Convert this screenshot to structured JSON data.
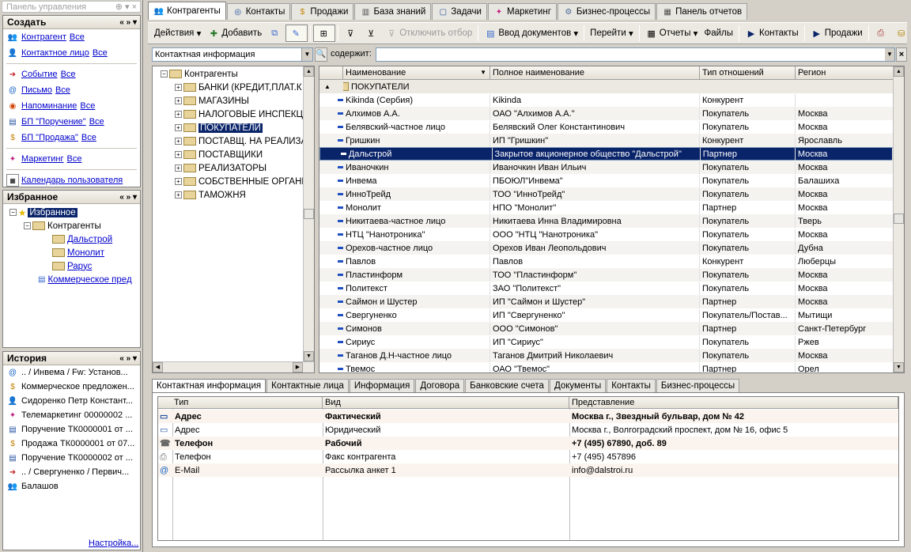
{
  "left_panel": {
    "title": "Панель управления",
    "create": {
      "header": "Создать",
      "items": [
        {
          "label": "Контрагент",
          "all": "Все",
          "icon": "people-icon"
        },
        {
          "label": "Контактное лицо",
          "all": "Все",
          "icon": "person-icon"
        },
        {
          "label": "Событие",
          "all": "Все",
          "icon": "event-icon"
        },
        {
          "label": "Письмо",
          "all": "Все",
          "icon": "mail-icon"
        },
        {
          "label": "Напоминание",
          "all": "Все",
          "icon": "reminder-icon"
        },
        {
          "label": "БП \"Поручение\"",
          "all": "Все",
          "icon": "task-icon"
        },
        {
          "label": "БП \"Продажа\"",
          "all": "Все",
          "icon": "sale-icon"
        },
        {
          "label": "Маркетинг",
          "all": "Все",
          "icon": "marketing-icon"
        }
      ],
      "calendar": "Календарь пользователя"
    },
    "favorites": {
      "header": "Избранное",
      "root": "Избранное",
      "group": "Контрагенты",
      "children": [
        "Дальстрой",
        "Монолит",
        "Рарус"
      ],
      "other": "Коммерческое пред"
    },
    "history": {
      "header": "История",
      "items": [
        ".. / Инвема / Fw: Установ...",
        "Коммерческое предложен...",
        "Сидоренко Петр Констант...",
        "Телемаркетинг 00000002 ...",
        "Поручение ТК0000001 от ...",
        "Продажа ТК0000001 от 07...",
        "Поручение ТК0000002 от ...",
        ".. / Свергуненко / Первич...",
        "Балашов"
      ]
    },
    "settings_link": "Настройка..."
  },
  "tabs": [
    {
      "label": "Контрагенты",
      "icon": "people-icon",
      "active": true
    },
    {
      "label": "Контакты",
      "icon": "contacts-icon"
    },
    {
      "label": "Продажи",
      "icon": "sales-icon"
    },
    {
      "label": "База знаний",
      "icon": "book-icon"
    },
    {
      "label": "Задачи",
      "icon": "tasks-icon"
    },
    {
      "label": "Маркетинг",
      "icon": "marketing-icon"
    },
    {
      "label": "Бизнес-процессы",
      "icon": "process-icon"
    },
    {
      "label": "Панель отчетов",
      "icon": "reports-icon"
    }
  ],
  "toolbar": {
    "actions": "Действия",
    "add": "Добавить",
    "disable_filter": "Отключить отбор",
    "enter_docs": "Ввод документов",
    "goto": "Перейти",
    "reports": "Отчеты",
    "files": "Файлы",
    "contacts": "Контакты",
    "sales": "Продажи"
  },
  "filter": {
    "field": "Контактная информация",
    "contains_label": "содержит:",
    "value": ""
  },
  "tree": {
    "root": "Контрагенты",
    "items": [
      "БАНКИ (КРЕДИТ,ПЛАТ.К",
      "МАГАЗИНЫ",
      "НАЛОГОВЫЕ ИНСПЕКЦ",
      "ПОКУПАТЕЛИ",
      "ПОСТАВЩ. НА РЕАЛИЗА",
      "ПОСТАВЩИКИ",
      "РЕАЛИЗАТОРЫ",
      "СОБСТВЕННЫЕ ОРГАНИ",
      "ТАМОЖНЯ"
    ],
    "selected_index": 3
  },
  "grid": {
    "columns": [
      "Наименование",
      "Полное наименование",
      "Тип отношений",
      "Регион"
    ],
    "group_row": "ПОКУПАТЕЛИ",
    "selected_index": 4,
    "rows": [
      [
        "Kikinda (Сербия)",
        "Kikinda",
        "Конкурент",
        ""
      ],
      [
        "Алхимов А.А.",
        "ОАО \"Алхимов А.А.\"",
        "Покупатель",
        "Москва"
      ],
      [
        "Белявский-частное лицо",
        "Белявский Олег Константинович",
        "Покупатель",
        "Москва"
      ],
      [
        "Гришкин",
        "ИП \"Гришкин\"",
        "Конкурент",
        "Ярославль"
      ],
      [
        "Дальстрой",
        "Закрытое акционерное общество \"Дальстрой\"",
        "Партнер",
        "Москва"
      ],
      [
        "Иваночкин",
        "Иваночкин Иван Ильич",
        "Покупатель",
        "Москва"
      ],
      [
        "Инвема",
        "ПБОЮЛ\"Инвема\"",
        "Покупатель",
        "Балашиха"
      ],
      [
        "ИнноТрейд",
        "ТОО \"ИнноТрейд\"",
        "Покупатель",
        "Москва"
      ],
      [
        "Монолит",
        "НПО \"Монолит\"",
        "Партнер",
        "Москва"
      ],
      [
        "Никитаева-частное лицо",
        "Никитаева Инна Владимировна",
        "Покупатель",
        "Тверь"
      ],
      [
        "НТЦ \"Нанотроника\"",
        "ООО \"НТЦ \"Нанотроника\"",
        "Покупатель",
        "Москва"
      ],
      [
        "Орехов-частное лицо",
        "Орехов Иван Леопольдович",
        "Покупатель",
        "Дубна"
      ],
      [
        "Павлов",
        "Павлов",
        "Конкурент",
        "Люберцы"
      ],
      [
        "Пластинформ",
        "ТОО \"Пластинформ\"",
        "Покупатель",
        "Москва"
      ],
      [
        "Политекст",
        "ЗАО \"Политекст\"",
        "Покупатель",
        "Москва"
      ],
      [
        "Саймон и Шустер",
        "ИП \"Саймон и Шустер\"",
        "Партнер",
        "Москва"
      ],
      [
        "Свергуненко",
        "ИП \"Свергуненко\"",
        "Покупатель/Постав...",
        "Мытищи"
      ],
      [
        "Симонов",
        "ООО \"Симонов\"",
        "Партнер",
        "Санкт-Петербург"
      ],
      [
        "Сириус",
        "ИП \"Сириус\"",
        "Покупатель",
        "Ржев"
      ],
      [
        "Таганов Д.Н-частное лицо",
        "Таганов Дмитрий Николаевич",
        "Покупатель",
        "Москва"
      ],
      [
        "Твемос",
        "ОАО \"Твемос\"",
        "Партнер",
        "Орел"
      ]
    ]
  },
  "bottom_tabs": [
    "Контактная информация",
    "Контактные лица",
    "Информация",
    "Договора",
    "Банковские счета",
    "Документы",
    "Контакты",
    "Бизнес-процессы"
  ],
  "contact_grid": {
    "columns": [
      "Тип",
      "Вид",
      "Представление"
    ],
    "rows": [
      {
        "type": "Адрес",
        "kind": "Фактический",
        "value": "Москва г., Звездный бульвар, дом № 42",
        "bold": true,
        "icon": "address-icon"
      },
      {
        "type": "Адрес",
        "kind": "Юридический",
        "value": "Москва г., Волгоградский проспект, дом № 16, офис 5",
        "bold": false,
        "icon": "address-icon"
      },
      {
        "type": "Телефон",
        "kind": "Рабочий",
        "value": "+7 (495) 67890, доб. 89",
        "bold": true,
        "icon": "phone-icon"
      },
      {
        "type": "Телефон",
        "kind": "Факс контрагента",
        "value": "+7 (495) 457896",
        "bold": false,
        "icon": "fax-icon"
      },
      {
        "type": "E-Mail",
        "kind": "Рассылка анкет 1",
        "value": "info@dalstroi.ru",
        "bold": false,
        "icon": "email-icon"
      }
    ]
  }
}
